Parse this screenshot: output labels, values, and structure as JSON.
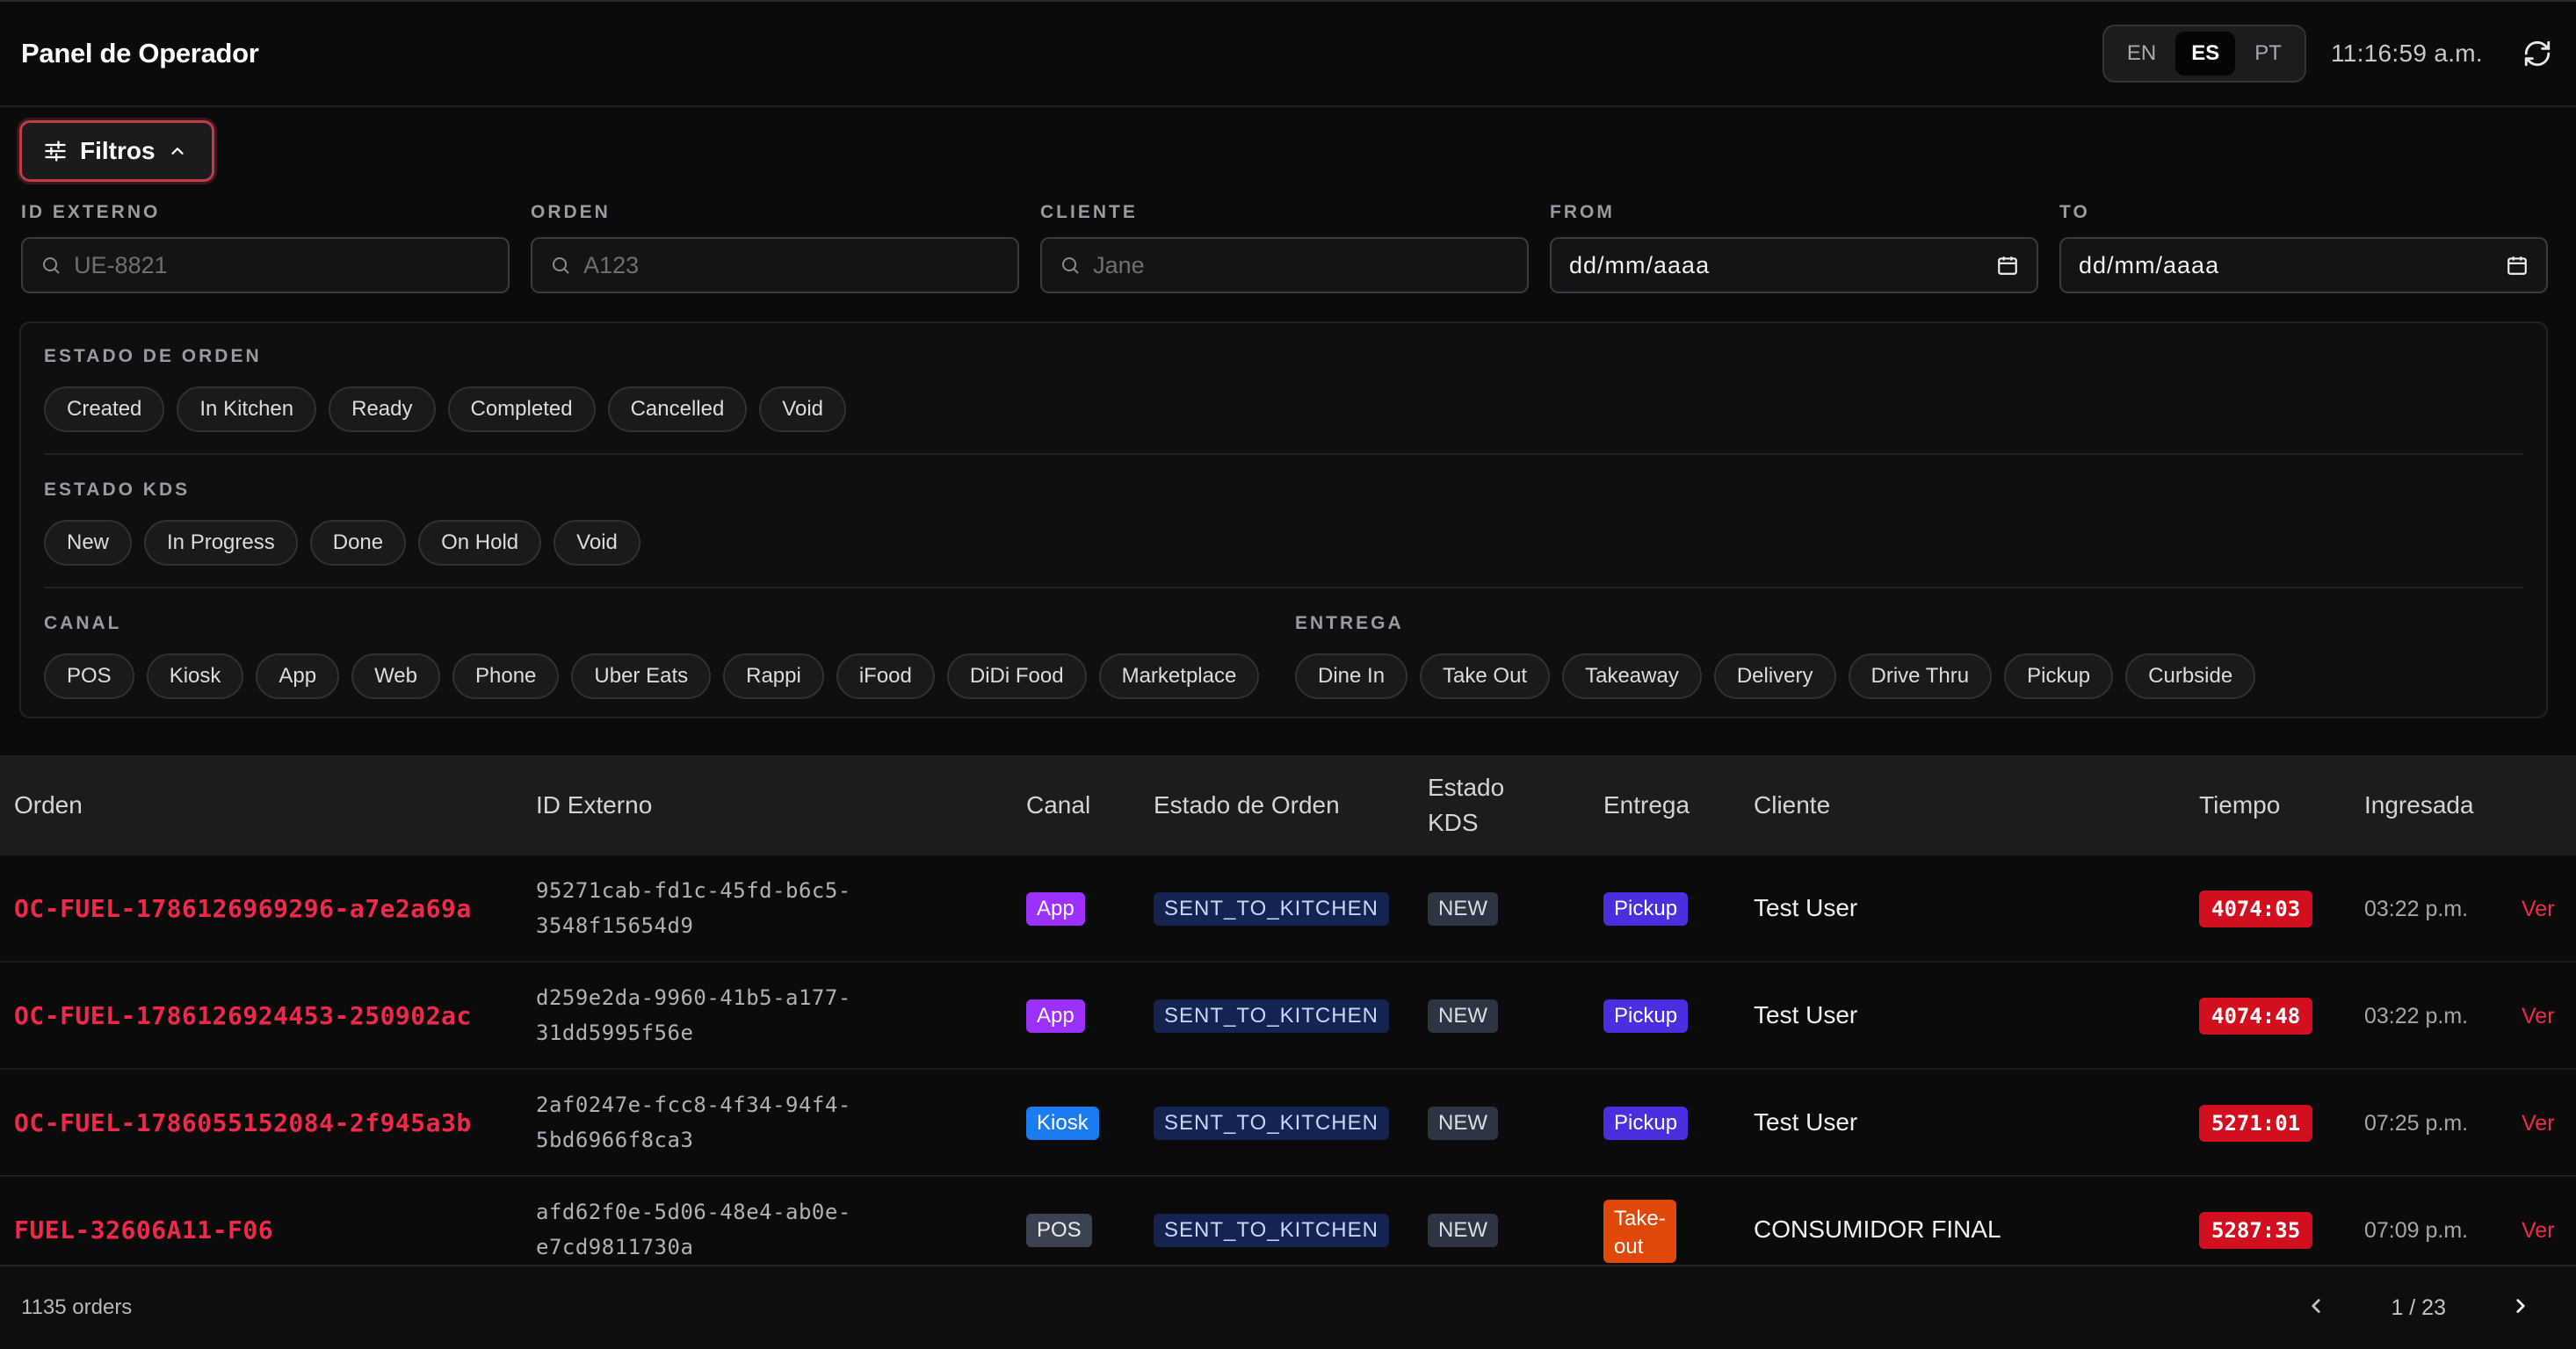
{
  "app": {
    "title": "Panel de Operador"
  },
  "header": {
    "languages": [
      "EN",
      "ES",
      "PT"
    ],
    "active_language": "ES",
    "clock": "11:16:59 a.m."
  },
  "filters": {
    "toggle_label": "Filtros",
    "fields": {
      "id_externo": {
        "label": "ID EXTERNO",
        "placeholder": "UE-8821"
      },
      "orden": {
        "label": "ORDEN",
        "placeholder": "A123"
      },
      "cliente": {
        "label": "CLIENTE",
        "placeholder": "Jane"
      },
      "from": {
        "label": "FROM",
        "value": "dd/mm/aaaa"
      },
      "to": {
        "label": "TO",
        "value": "dd/mm/aaaa"
      }
    },
    "estado_orden": {
      "label": "ESTADO DE ORDEN",
      "options": [
        "Created",
        "In Kitchen",
        "Ready",
        "Completed",
        "Cancelled",
        "Void"
      ]
    },
    "estado_kds": {
      "label": "ESTADO KDS",
      "options": [
        "New",
        "In Progress",
        "Done",
        "On Hold",
        "Void"
      ]
    },
    "canal": {
      "label": "CANAL",
      "options": [
        "POS",
        "Kiosk",
        "App",
        "Web",
        "Phone",
        "Uber Eats",
        "Rappi",
        "iFood",
        "DiDi Food",
        "Marketplace"
      ]
    },
    "entrega": {
      "label": "ENTREGA",
      "options": [
        "Dine In",
        "Take Out",
        "Takeaway",
        "Delivery",
        "Drive Thru",
        "Pickup",
        "Curbside"
      ]
    }
  },
  "table": {
    "columns": {
      "orden": "Orden",
      "id_externo": "ID Externo",
      "canal": "Canal",
      "estado_orden": "Estado de Orden",
      "estado_kds_1": "Estado",
      "estado_kds_2": "KDS",
      "entrega": "Entrega",
      "cliente": "Cliente",
      "tiempo": "Tiempo",
      "ingresada": "Ingresada"
    },
    "rows": [
      {
        "orden": "OC-FUEL-1786126969296-a7e2a69a",
        "ext1": "95271cab-fd1c-45fd-b6c5-",
        "ext2": "3548f15654d9",
        "canal": "App",
        "estado": "SENT_TO_KITCHEN",
        "kds": "NEW",
        "entrega": "Pickup",
        "cliente": "Test User",
        "tiempo": "4074:03",
        "ingresada": "03:22 p.m.",
        "accion": "Ver"
      },
      {
        "orden": "OC-FUEL-1786126924453-250902ac",
        "ext1": "d259e2da-9960-41b5-a177-",
        "ext2": "31dd5995f56e",
        "canal": "App",
        "estado": "SENT_TO_KITCHEN",
        "kds": "NEW",
        "entrega": "Pickup",
        "cliente": "Test User",
        "tiempo": "4074:48",
        "ingresada": "03:22 p.m.",
        "accion": "Ver"
      },
      {
        "orden": "OC-FUEL-1786055152084-2f945a3b",
        "ext1": "2af0247e-fcc8-4f34-94f4-",
        "ext2": "5bd6966f8ca3",
        "canal": "Kiosk",
        "estado": "SENT_TO_KITCHEN",
        "kds": "NEW",
        "entrega": "Pickup",
        "cliente": "Test User",
        "tiempo": "5271:01",
        "ingresada": "07:25 p.m.",
        "accion": "Ver"
      },
      {
        "orden": "FUEL-32606A11-F06",
        "ext1": "afd62f0e-5d06-48e4-ab0e-",
        "ext2": "e7cd9811730a",
        "canal": "POS",
        "estado": "SENT_TO_KITCHEN",
        "kds": "NEW",
        "entrega1": "Take-",
        "entrega2": "out",
        "cliente": "CONSUMIDOR FINAL",
        "tiempo": "5287:35",
        "ingresada": "07:09 p.m.",
        "accion": "Ver"
      }
    ]
  },
  "footer": {
    "orders_count": "1135 orders",
    "page": "1 / 23"
  }
}
